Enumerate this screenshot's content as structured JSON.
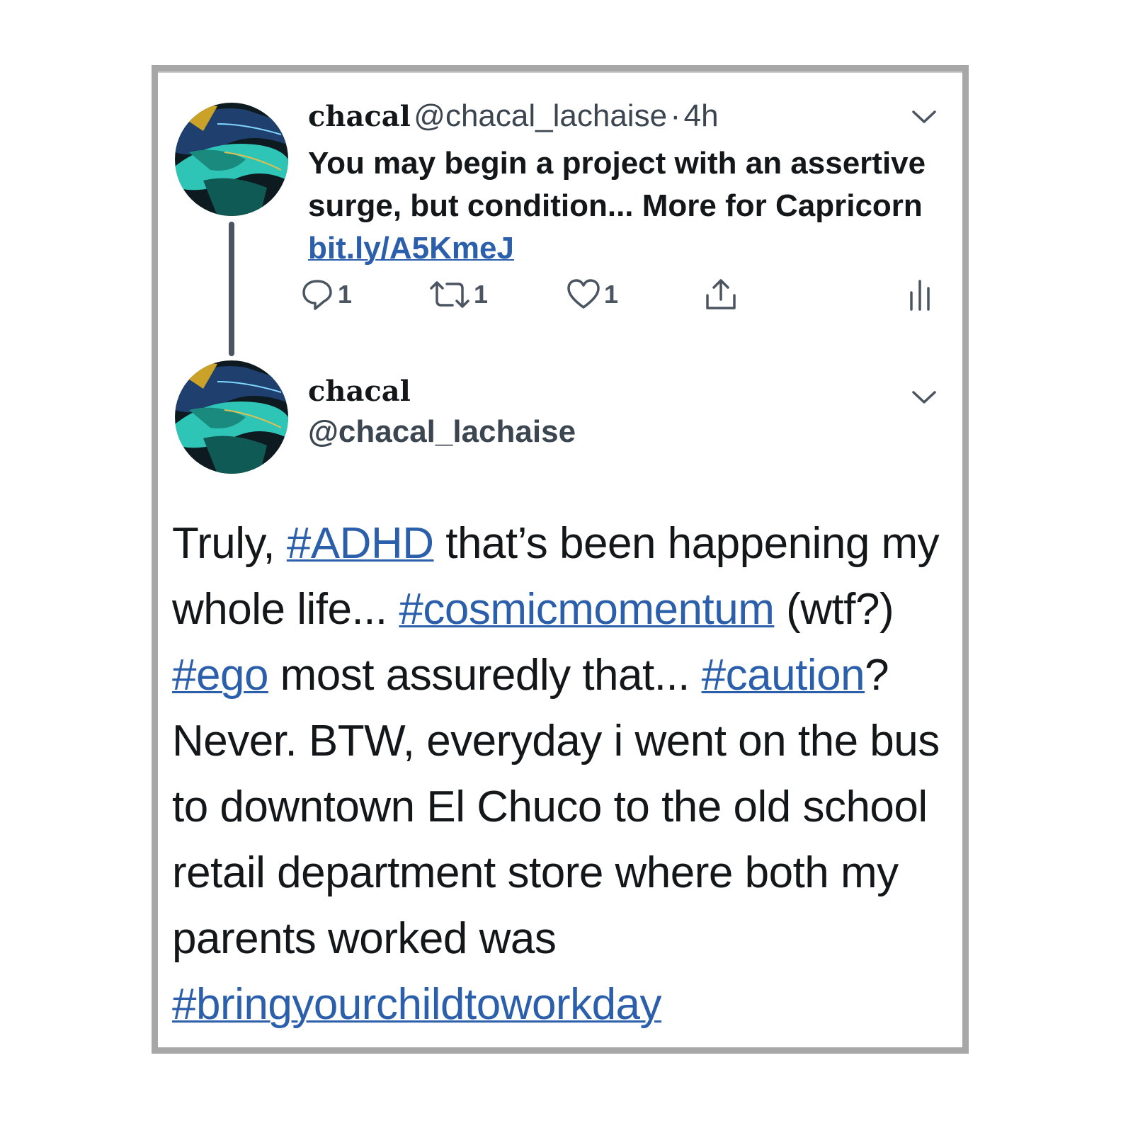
{
  "tweet1": {
    "display_name": "chacal",
    "handle": "@chacal_lachaise",
    "separator": "·",
    "time": "4h",
    "text": "You may begin a project with an assertive surge, but condition... More for Capricorn ",
    "link": "bit.ly/A5KmeJ",
    "actions": {
      "reply_count": "1",
      "retweet_count": "1",
      "like_count": "1"
    }
  },
  "tweet2": {
    "display_name": "chacal",
    "handle": "@chacal_lachaise",
    "body": {
      "t1": "Truly, ",
      "tag1": "#ADHD",
      "t2": " that’s been happening my whole life...  ",
      "tag2": "#cosmicmomentum",
      "t3": " (wtf?) ",
      "tag3": "#ego",
      "t4": " most assuredly that... ",
      "tag4": "#caution",
      "t5": "? Never. BTW, everyday i went on the bus to downtown El Chuco to the old school retail department store where both my parents worked was ",
      "tag5": "#bringyourchildtoworkday"
    }
  },
  "icons": {
    "menu": "chevron-down-icon",
    "reply": "reply-icon",
    "retweet": "retweet-icon",
    "like": "heart-icon",
    "share": "share-icon",
    "analytics": "analytics-icon"
  },
  "colors": {
    "link": "#2b5fab",
    "text": "#14171a",
    "muted": "#3b4651",
    "frame": "#a7a7a7"
  }
}
